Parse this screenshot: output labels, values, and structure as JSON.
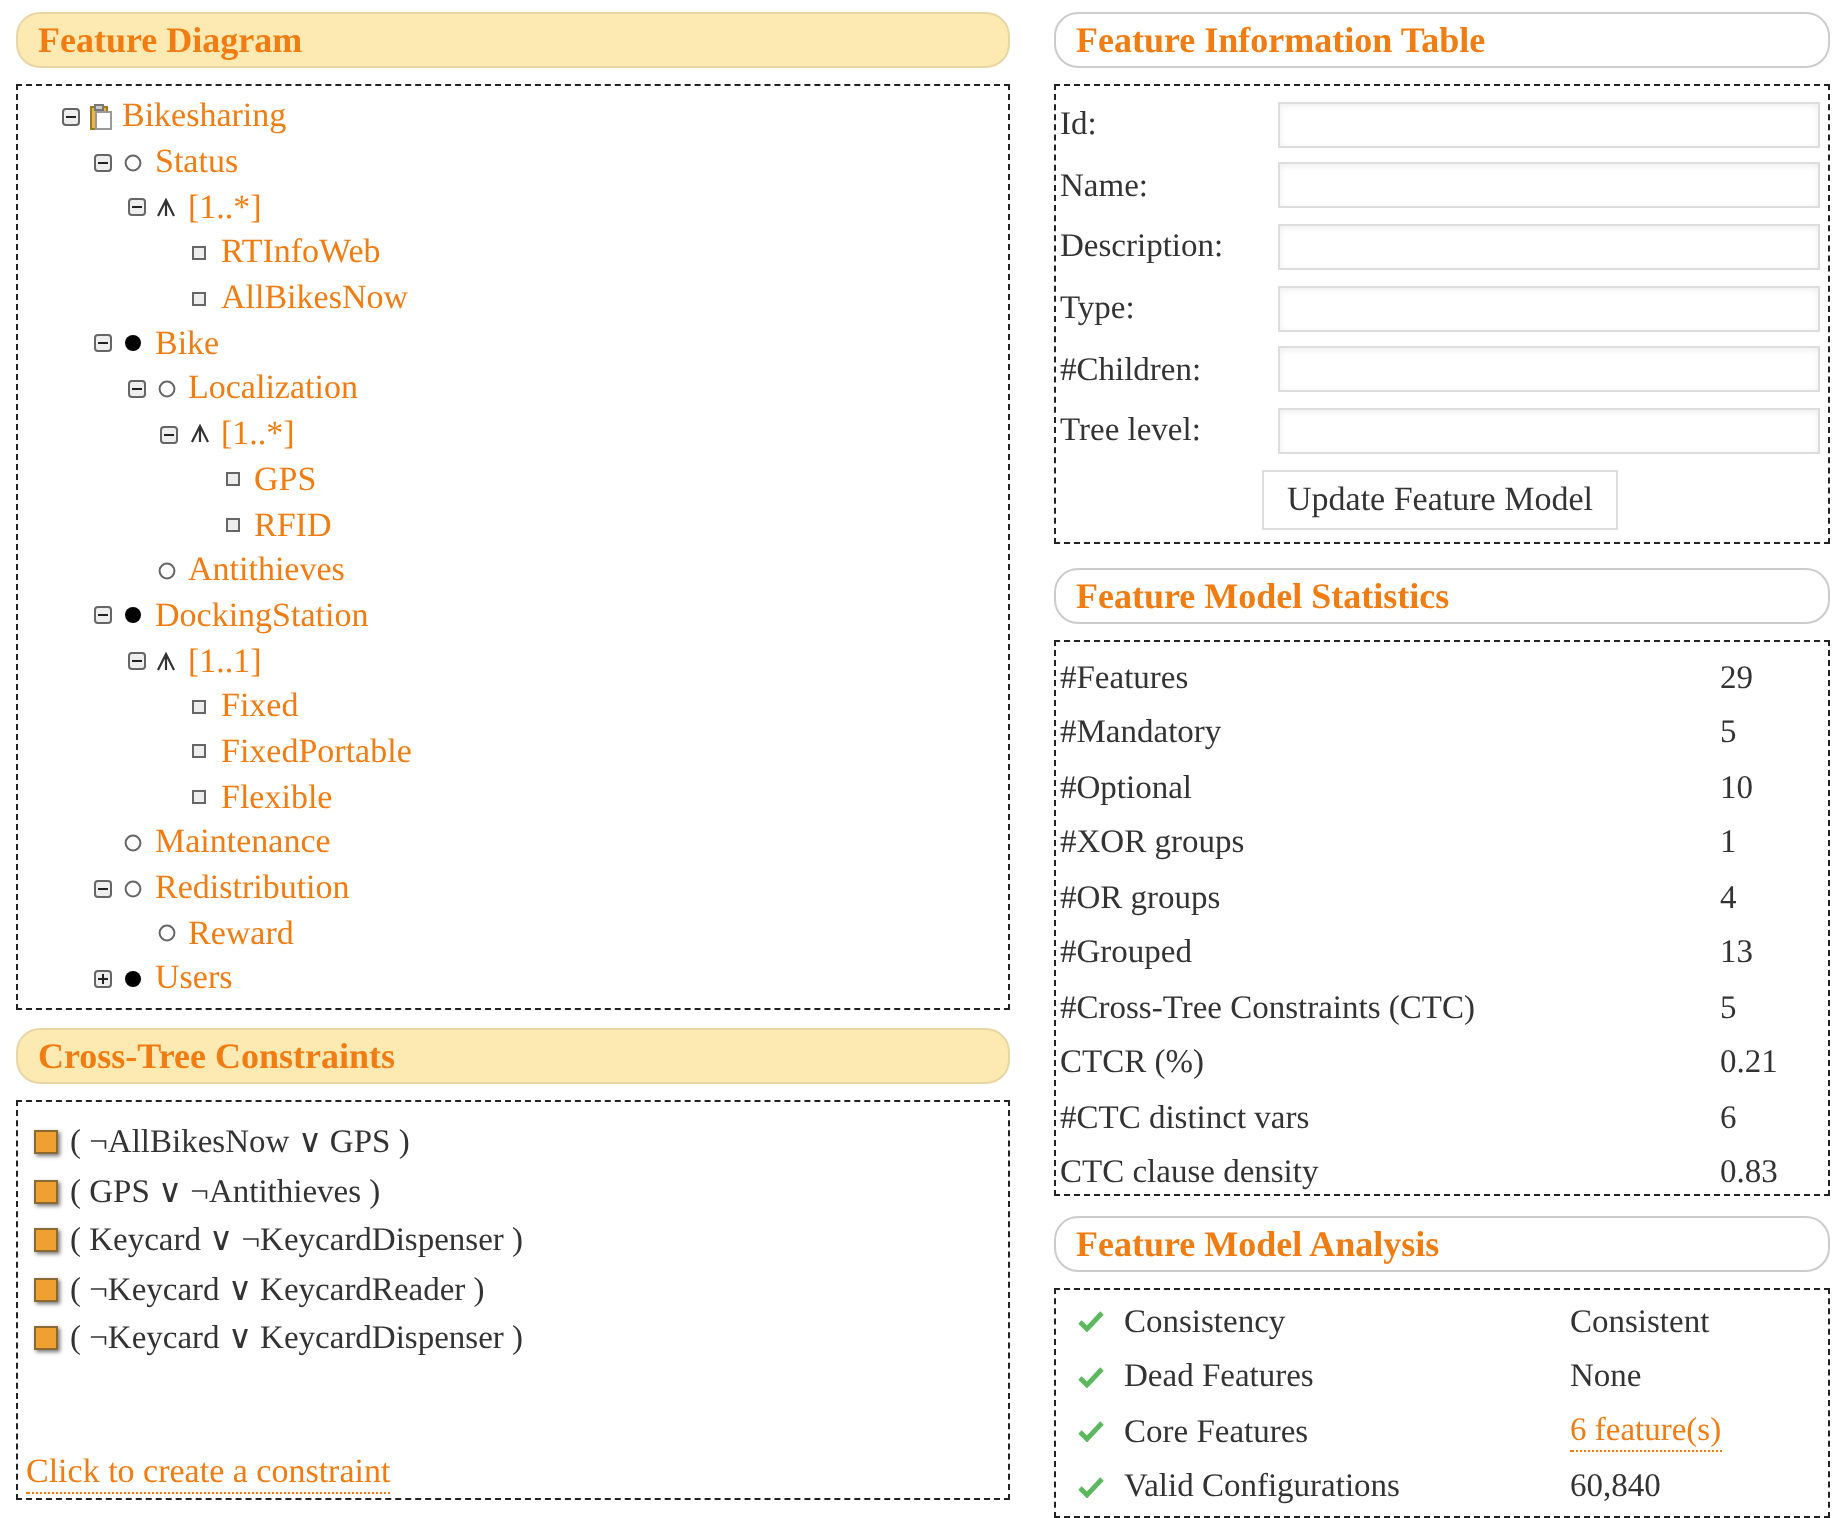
{
  "feature_diagram": {
    "title": "Feature Diagram",
    "tree": [
      {
        "label": "Bikesharing",
        "kind": "root",
        "expanded": true,
        "children": [
          {
            "label": "Status",
            "kind": "optional",
            "expanded": true,
            "children": [
              {
                "label": "[1..*]",
                "kind": "group",
                "expanded": true,
                "children": [
                  {
                    "label": "RTInfoWeb",
                    "kind": "grouped"
                  },
                  {
                    "label": "AllBikesNow",
                    "kind": "grouped"
                  }
                ]
              }
            ]
          },
          {
            "label": "Bike",
            "kind": "mandatory",
            "expanded": true,
            "children": [
              {
                "label": "Localization",
                "kind": "optional",
                "expanded": true,
                "children": [
                  {
                    "label": "[1..*]",
                    "kind": "group",
                    "expanded": true,
                    "children": [
                      {
                        "label": "GPS",
                        "kind": "grouped"
                      },
                      {
                        "label": "RFID",
                        "kind": "grouped"
                      }
                    ]
                  }
                ]
              },
              {
                "label": "Antithieves",
                "kind": "optional"
              }
            ]
          },
          {
            "label": "DockingStation",
            "kind": "mandatory",
            "expanded": true,
            "children": [
              {
                "label": "[1..1]",
                "kind": "group",
                "expanded": true,
                "children": [
                  {
                    "label": "Fixed",
                    "kind": "grouped"
                  },
                  {
                    "label": "FixedPortable",
                    "kind": "grouped"
                  },
                  {
                    "label": "Flexible",
                    "kind": "grouped"
                  }
                ]
              }
            ]
          },
          {
            "label": "Maintenance",
            "kind": "optional"
          },
          {
            "label": "Redistribution",
            "kind": "optional",
            "expanded": true,
            "children": [
              {
                "label": "Reward",
                "kind": "optional"
              }
            ]
          },
          {
            "label": "Users",
            "kind": "mandatory",
            "expanded": false
          }
        ]
      }
    ]
  },
  "cross_tree_constraints": {
    "title": "Cross-Tree Constraints",
    "items": [
      "( ¬AllBikesNow ∨ GPS )",
      "( GPS ∨ ¬Antithieves )",
      "( Keycard ∨ ¬KeycardDispenser )",
      "( ¬Keycard ∨ KeycardReader )",
      "( ¬Keycard ∨ KeycardDispenser )"
    ],
    "create_link": "Click to create a constraint"
  },
  "feature_information_table": {
    "title": "Feature Information Table",
    "fields": [
      {
        "label": "Id:"
      },
      {
        "label": "Name:"
      },
      {
        "label": "Description:"
      },
      {
        "label": "Type:"
      },
      {
        "label": "#Children:"
      },
      {
        "label": "Tree level:"
      }
    ],
    "button": "Update Feature Model"
  },
  "feature_model_statistics": {
    "title": "Feature Model Statistics",
    "rows": [
      {
        "label": "#Features",
        "value": "29"
      },
      {
        "label": "#Mandatory",
        "value": "5"
      },
      {
        "label": "#Optional",
        "value": "10"
      },
      {
        "label": "#XOR groups",
        "value": "1"
      },
      {
        "label": "#OR groups",
        "value": "4"
      },
      {
        "label": "#Grouped",
        "value": "13"
      },
      {
        "label": "#Cross-Tree Constraints (CTC)",
        "value": "5"
      },
      {
        "label": "CTCR (%)",
        "value": "0.21"
      },
      {
        "label": "#CTC distinct vars",
        "value": "6"
      },
      {
        "label": "CTC clause density",
        "value": "0.83"
      }
    ]
  },
  "feature_model_analysis": {
    "title": "Feature Model Analysis",
    "rows": [
      {
        "label": "Consistency",
        "value": "Consistent",
        "kind": "text"
      },
      {
        "label": "Dead Features",
        "value": "None",
        "kind": "text"
      },
      {
        "label": "Core Features",
        "value": "6 feature(s)",
        "kind": "link"
      },
      {
        "label": "Valid Configurations",
        "value": "60,840",
        "kind": "text"
      }
    ]
  }
}
